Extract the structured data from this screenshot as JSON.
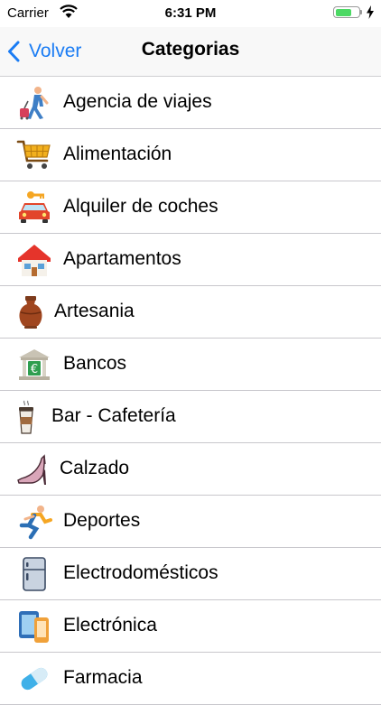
{
  "status_bar": {
    "carrier": "Carrier",
    "time": "6:31 PM",
    "battery_level": 0.7
  },
  "nav": {
    "back_label": "Volver",
    "title": "Categorias"
  },
  "colors": {
    "accent": "#1a7cf4",
    "separator": "#c8c7cc",
    "battery": "#4cd964"
  },
  "categories": [
    {
      "label": "Agencia de viajes",
      "icon": "traveler-icon"
    },
    {
      "label": "Alimentación",
      "icon": "shopping-cart-icon"
    },
    {
      "label": "Alquiler de coches",
      "icon": "car-key-icon"
    },
    {
      "label": "Apartamentos",
      "icon": "house-icon"
    },
    {
      "label": "Artesania",
      "icon": "vase-icon"
    },
    {
      "label": "Bancos",
      "icon": "bank-icon"
    },
    {
      "label": "Bar - Cafetería",
      "icon": "coffee-cup-icon"
    },
    {
      "label": "Calzado",
      "icon": "high-heel-icon"
    },
    {
      "label": "Deportes",
      "icon": "runner-icon"
    },
    {
      "label": "Electrodomésticos",
      "icon": "fridge-icon"
    },
    {
      "label": "Electrónica",
      "icon": "devices-icon"
    },
    {
      "label": "Farmacia",
      "icon": "pill-icon"
    }
  ]
}
